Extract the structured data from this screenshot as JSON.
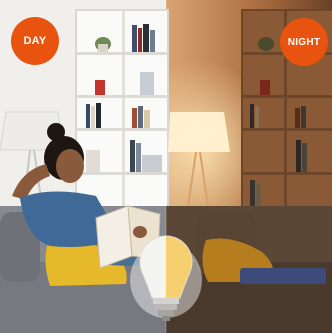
{
  "badges": {
    "day_label": "DAY",
    "night_label": "NIGHT"
  },
  "colors": {
    "badge": "#e8530f",
    "day_wall": "#f1efec",
    "night_wall": "#b98253",
    "sofa_day": "#76797f",
    "sofa_night": "#4a3a2e",
    "pillow_day": "#e6b92a",
    "pillow_night": "#b57d1d"
  },
  "icons": {
    "bulb": "light-bulb-icon"
  }
}
